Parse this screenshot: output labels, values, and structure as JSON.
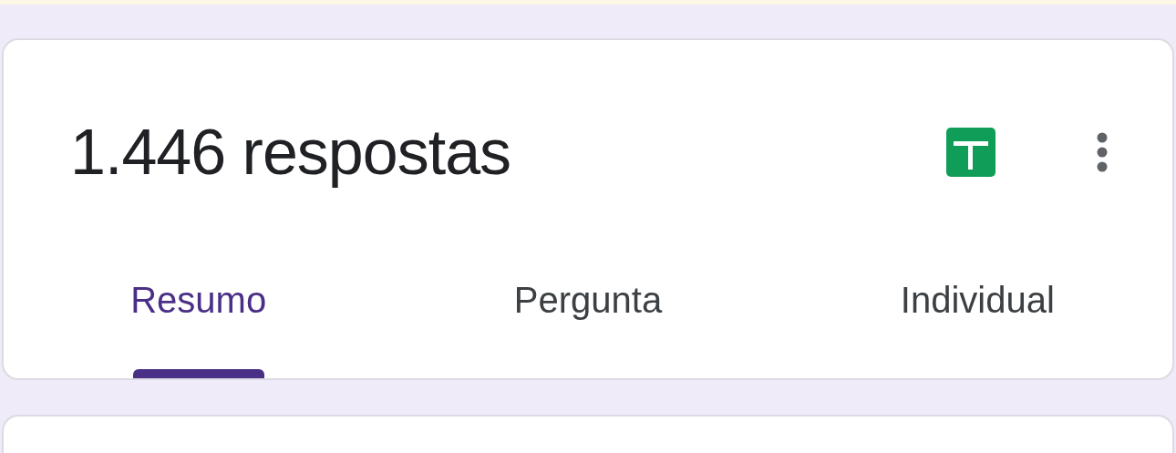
{
  "header": {
    "title": "1.446 respostas"
  },
  "tabs": [
    {
      "label": "Resumo",
      "selected": true
    },
    {
      "label": "Pergunta",
      "selected": false
    },
    {
      "label": "Individual",
      "selected": false
    }
  ]
}
